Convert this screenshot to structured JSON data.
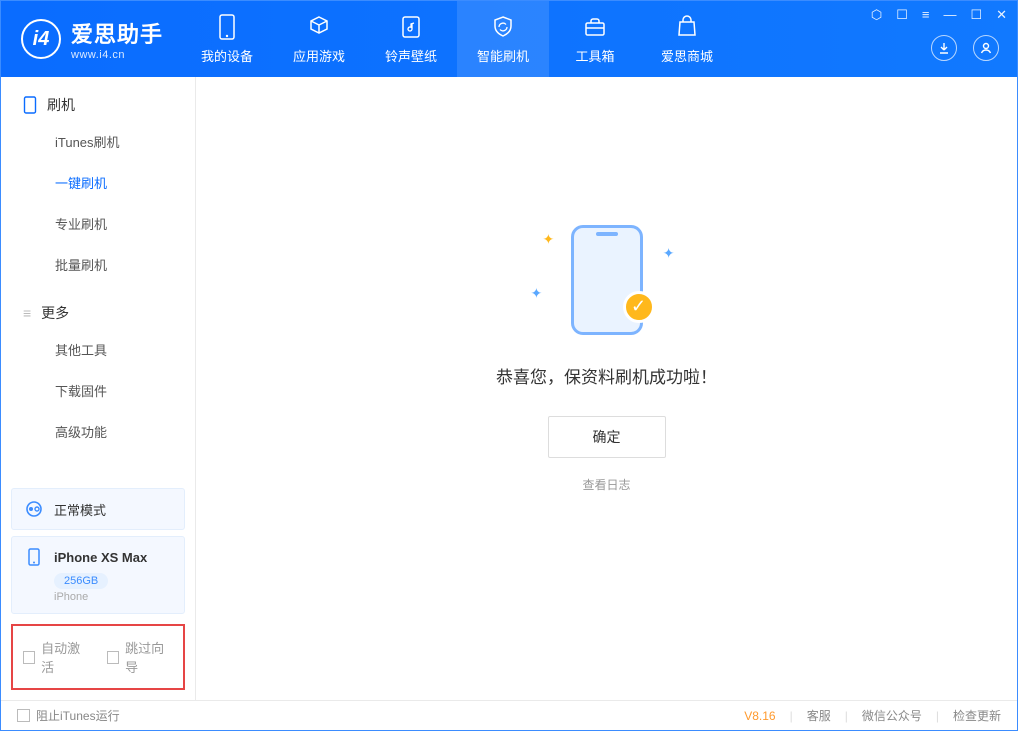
{
  "app": {
    "title": "爱思助手",
    "subtitle": "www.i4.cn"
  },
  "nav": {
    "items": [
      {
        "label": "我的设备"
      },
      {
        "label": "应用游戏"
      },
      {
        "label": "铃声壁纸"
      },
      {
        "label": "智能刷机"
      },
      {
        "label": "工具箱"
      },
      {
        "label": "爱思商城"
      }
    ],
    "active_index": 3
  },
  "sidebar": {
    "group1": {
      "title": "刷机",
      "items": [
        "iTunes刷机",
        "一键刷机",
        "专业刷机",
        "批量刷机"
      ],
      "active_index": 1
    },
    "group2": {
      "title": "更多",
      "items": [
        "其他工具",
        "下载固件",
        "高级功能"
      ]
    },
    "mode": "正常模式",
    "device": {
      "name": "iPhone XS Max",
      "capacity": "256GB",
      "type": "iPhone"
    },
    "options": {
      "auto_activate": "自动激活",
      "skip_guide": "跳过向导"
    }
  },
  "main": {
    "message": "恭喜您，保资料刷机成功啦！",
    "ok": "确定",
    "view_log": "查看日志"
  },
  "footer": {
    "block_itunes": "阻止iTunes运行",
    "version": "V8.16",
    "support": "客服",
    "wechat": "微信公众号",
    "update": "检查更新"
  }
}
